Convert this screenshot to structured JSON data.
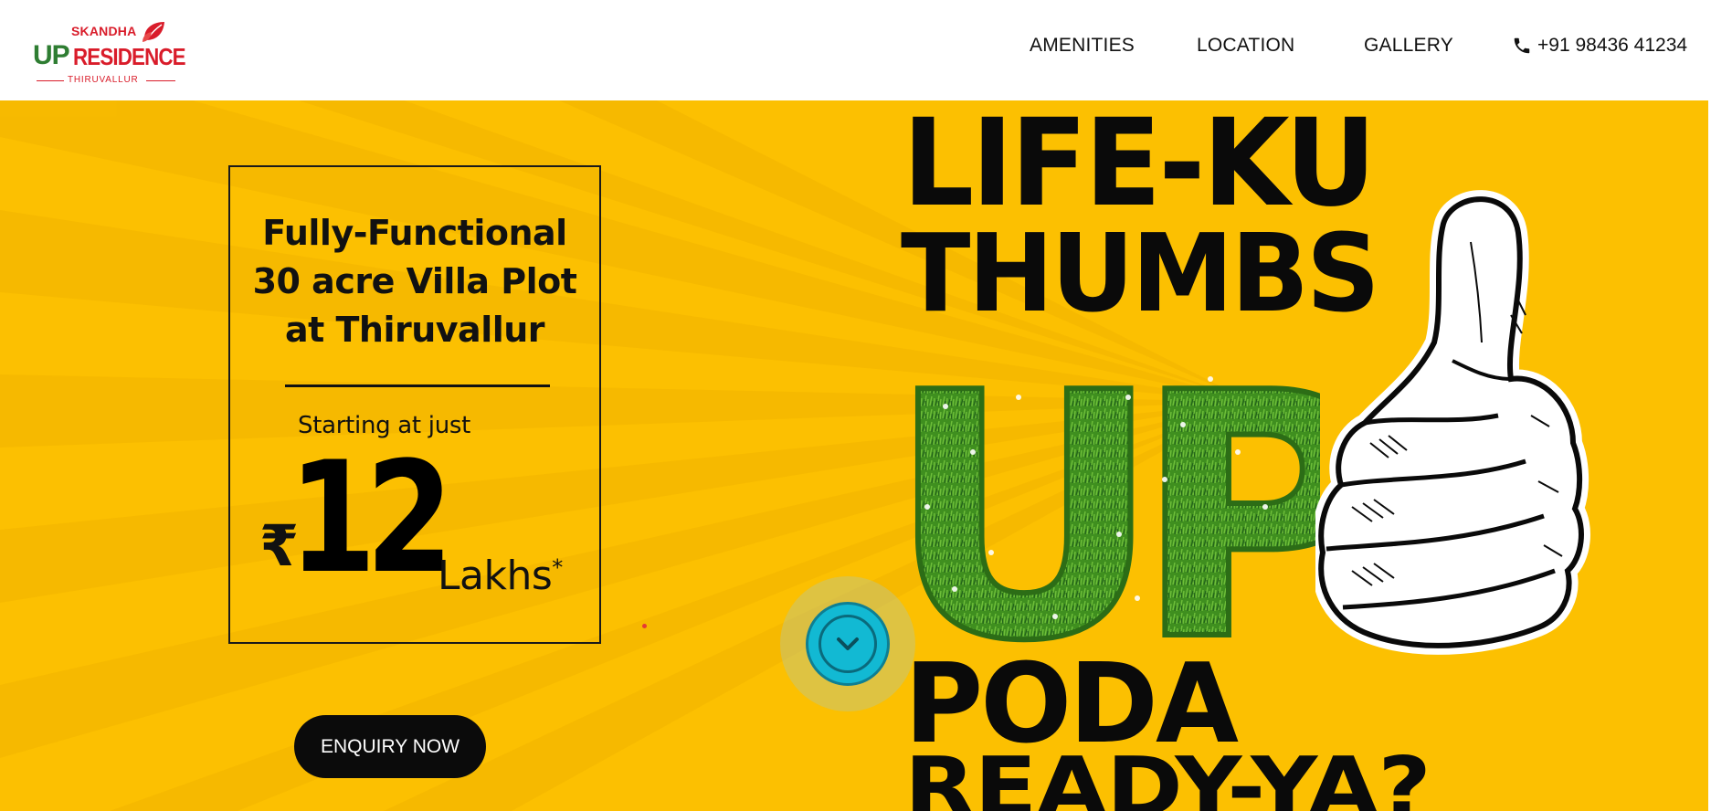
{
  "header": {
    "logo": {
      "brand_top": "SKANDHA",
      "brand_up": "UP",
      "brand_residence": "RESIDENCE",
      "brand_sub": "THIRUVALLUR"
    },
    "nav": [
      {
        "label": "AMENITIES"
      },
      {
        "label": "LOCATION"
      },
      {
        "label": "GALLERY"
      }
    ],
    "phone": {
      "icon": "phone-icon",
      "number": "+91 98436 41234"
    }
  },
  "hero": {
    "background_color": "#fcc001",
    "offer": {
      "title_line1": "Fully-Functional",
      "title_line2": "30 acre Villa Plot",
      "title_line3": "at Thiruvallur",
      "starting_text": "Starting at just",
      "currency": "₹",
      "amount": "12",
      "unit": "Lakhs",
      "unit_mark": "*"
    },
    "cta": {
      "label": "ENQUIRY NOW"
    },
    "scroll_button": {
      "icon": "chevron-down-icon"
    },
    "headline": {
      "line1": "LIFE-KU",
      "line2": "THUMBS",
      "line3": "UP",
      "line4": "PODA",
      "line5": "READY-YA?"
    },
    "art": {
      "grass_letters_icon": "grass-up-icon",
      "hand_icon": "thumbs-up-hand-icon"
    }
  },
  "colors": {
    "brand_red": "#d91c2a",
    "brand_green": "#2e7d32",
    "hero_yellow": "#fcc001",
    "button_dark": "#0b0b0b",
    "scroll_cyan": "#12b9d3"
  }
}
